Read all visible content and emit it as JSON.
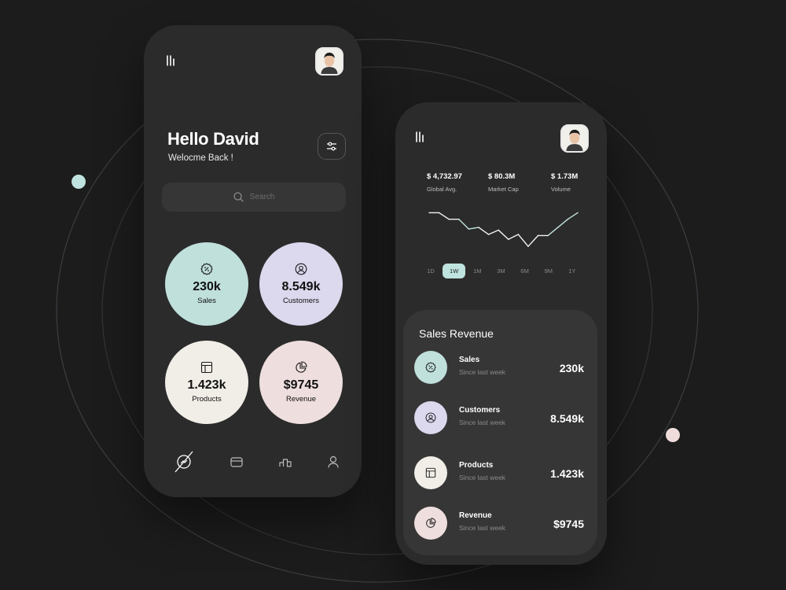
{
  "colors": {
    "background": "#1c1c1c",
    "phone": "#2b2b2b",
    "teal": "#c0e0dc",
    "lavender": "#dcd8ee",
    "cream": "#f0eee7",
    "pink": "#efdede",
    "teal_dot": "#bfe3de",
    "pink_dot": "#f1dcdc"
  },
  "home": {
    "menu_icon": "menu-icon",
    "greeting": "Hello David",
    "welcome": "Welocme Back !",
    "filter_icon": "sliders-icon",
    "search": {
      "icon": "search-icon",
      "placeholder": "Search"
    },
    "cards": [
      {
        "icon": "discount-badge-icon",
        "value": "230k",
        "label": "Sales",
        "color": "#c0e0dc"
      },
      {
        "icon": "user-circle-icon",
        "value": "8.549k",
        "label": "Customers",
        "color": "#dcd8ee"
      },
      {
        "icon": "layout-icon",
        "value": "1.423k",
        "label": "Products",
        "color": "#f0eee7"
      },
      {
        "icon": "pie-chart-icon",
        "value": "$9745",
        "label": "Revenue",
        "color": "#efdede"
      }
    ],
    "nav": [
      "dashboard-icon",
      "wallet-icon",
      "leaderboard-icon",
      "profile-icon"
    ]
  },
  "detail": {
    "stats": [
      {
        "value": "$ 4,732.97",
        "label": "Global Avg."
      },
      {
        "value": "$ 80.3M",
        "label": "Market Cap"
      },
      {
        "value": "$ 1.73M",
        "label": "Volume"
      }
    ],
    "ranges": [
      "1D",
      "1W",
      "1M",
      "3M",
      "6M",
      "9M",
      "1Y"
    ],
    "active_range": "1W",
    "sales_revenue": {
      "title": "Sales Revenue",
      "rows": [
        {
          "icon": "discount-badge-icon",
          "name": "Sales",
          "since": "Since last week",
          "value": "230k",
          "color": "#c0e0dc"
        },
        {
          "icon": "user-circle-icon",
          "name": "Customers",
          "since": "Since last week",
          "value": "8.549k",
          "color": "#dcd8ee"
        },
        {
          "icon": "layout-icon",
          "name": "Products",
          "since": "Since last week",
          "value": "1.423k",
          "color": "#f0eee7"
        },
        {
          "icon": "pie-chart-icon",
          "name": "Revenue",
          "since": "Since last week",
          "value": "$9745",
          "color": "#efdede"
        }
      ]
    }
  },
  "chart_data": {
    "type": "line",
    "x": [
      0,
      1,
      2,
      3,
      4,
      5,
      6,
      7,
      8,
      9,
      10,
      11,
      12,
      13,
      14,
      15
    ],
    "values": [
      82,
      82,
      70,
      70,
      52,
      55,
      42,
      50,
      33,
      42,
      20,
      40,
      40,
      55,
      70,
      82
    ],
    "ylim": [
      0,
      100
    ],
    "title": "",
    "xlabel": "",
    "ylabel": "",
    "grid": false,
    "colors": {
      "line": "#f2f2f2",
      "highlight": "#bfe3de"
    }
  }
}
